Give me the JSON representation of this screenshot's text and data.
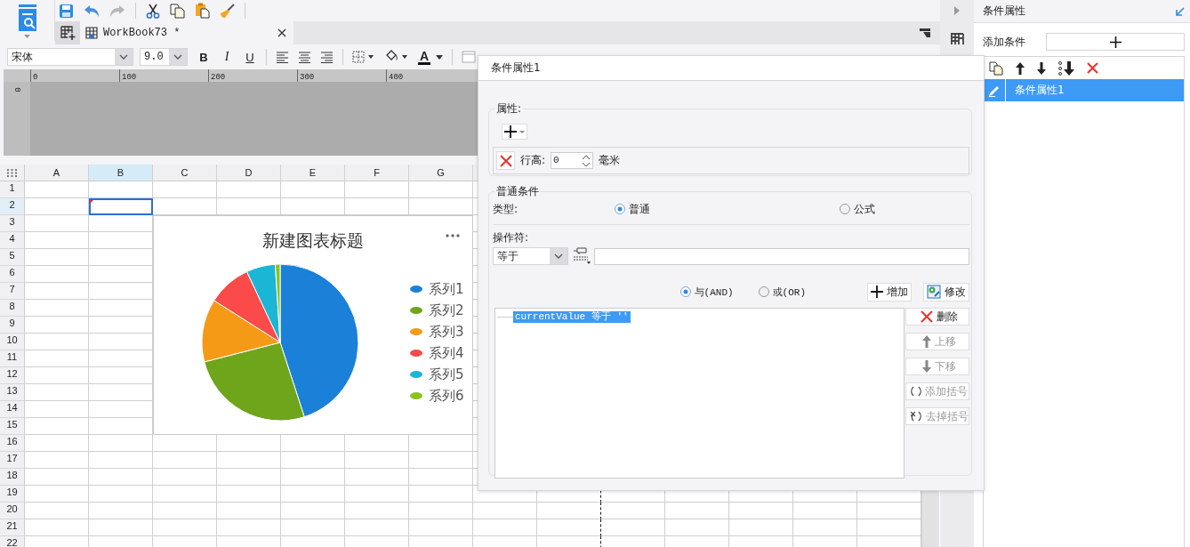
{
  "workbook_tabs": [
    {
      "label": "WorkBook73 *",
      "selected": true
    }
  ],
  "format_bar": {
    "font": "宋体",
    "size": "9.0",
    "bold": "B",
    "italic": "I",
    "underline": "U",
    "font_color": "A"
  },
  "ruler": {
    "ticks": [
      "0",
      "100",
      "200",
      "300",
      "400"
    ],
    "side": "0"
  },
  "sheet": {
    "columns": [
      {
        "label": "A",
        "selected": false
      },
      {
        "label": "B",
        "selected": true
      },
      {
        "label": "C",
        "selected": false
      },
      {
        "label": "D",
        "selected": false
      },
      {
        "label": "E",
        "selected": false
      },
      {
        "label": "F",
        "selected": false
      },
      {
        "label": "G",
        "selected": false
      }
    ],
    "rows": [
      {
        "label": "1",
        "selected": false
      },
      {
        "label": "2",
        "selected": true
      },
      {
        "label": "3",
        "selected": false
      },
      {
        "label": "4",
        "selected": false
      },
      {
        "label": "5",
        "selected": false
      },
      {
        "label": "6",
        "selected": false
      },
      {
        "label": "7",
        "selected": false
      },
      {
        "label": "8",
        "selected": false
      },
      {
        "label": "9",
        "selected": false
      },
      {
        "label": "10",
        "selected": false
      },
      {
        "label": "11",
        "selected": false
      },
      {
        "label": "12",
        "selected": false
      },
      {
        "label": "13",
        "selected": false
      },
      {
        "label": "14",
        "selected": false
      },
      {
        "label": "15",
        "selected": false
      },
      {
        "label": "16",
        "selected": false
      },
      {
        "label": "17",
        "selected": false
      },
      {
        "label": "18",
        "selected": false
      },
      {
        "label": "19",
        "selected": false
      },
      {
        "label": "20",
        "selected": false
      },
      {
        "label": "21",
        "selected": false
      },
      {
        "label": "22",
        "selected": false
      }
    ]
  },
  "chart": {
    "title": "新建图表标题",
    "legend": [
      {
        "label": "系列1",
        "color": "#1a80d8"
      },
      {
        "label": "系列2",
        "color": "#6fa51a"
      },
      {
        "label": "系列3",
        "color": "#f59a16"
      },
      {
        "label": "系列4",
        "color": "#fa4a4a"
      },
      {
        "label": "系列5",
        "color": "#1bb5d6"
      },
      {
        "label": "系列6",
        "color": "#8cc21e"
      }
    ]
  },
  "dialog": {
    "title": "条件属性1",
    "attributes": {
      "label": "属性:",
      "rows": [
        {
          "label": "行高:",
          "value": "0",
          "unit": "毫米"
        }
      ]
    },
    "condition": {
      "label": "普通条件",
      "type_label": "类型:",
      "types": [
        {
          "label": "普通",
          "selected": true
        },
        {
          "label": "公式",
          "selected": false
        }
      ],
      "operator_label": "操作符:",
      "operator": "等于",
      "logic": [
        {
          "label": "与(AND)",
          "selected": true
        },
        {
          "label": "或(OR)",
          "selected": false
        }
      ],
      "actions": [
        {
          "label": "增加",
          "kind": "add"
        },
        {
          "label": "修改",
          "kind": "edit"
        }
      ],
      "items": [
        {
          "text": "currentValue 等于 ''",
          "selected": true
        }
      ],
      "side_buttons": [
        {
          "label": "删除",
          "kind": "delete",
          "disabled": false
        },
        {
          "label": "上移",
          "kind": "up",
          "disabled": true
        },
        {
          "label": "下移",
          "kind": "down",
          "disabled": true
        },
        {
          "label": "添加括号",
          "kind": "add_paren",
          "disabled": true
        },
        {
          "label": "去掉括号",
          "kind": "remove_paren",
          "disabled": true
        }
      ]
    }
  },
  "side_panel": {
    "title": "条件属性",
    "add_label": "添加条件",
    "items": [
      {
        "label": "条件属性1",
        "selected": true
      }
    ]
  }
}
